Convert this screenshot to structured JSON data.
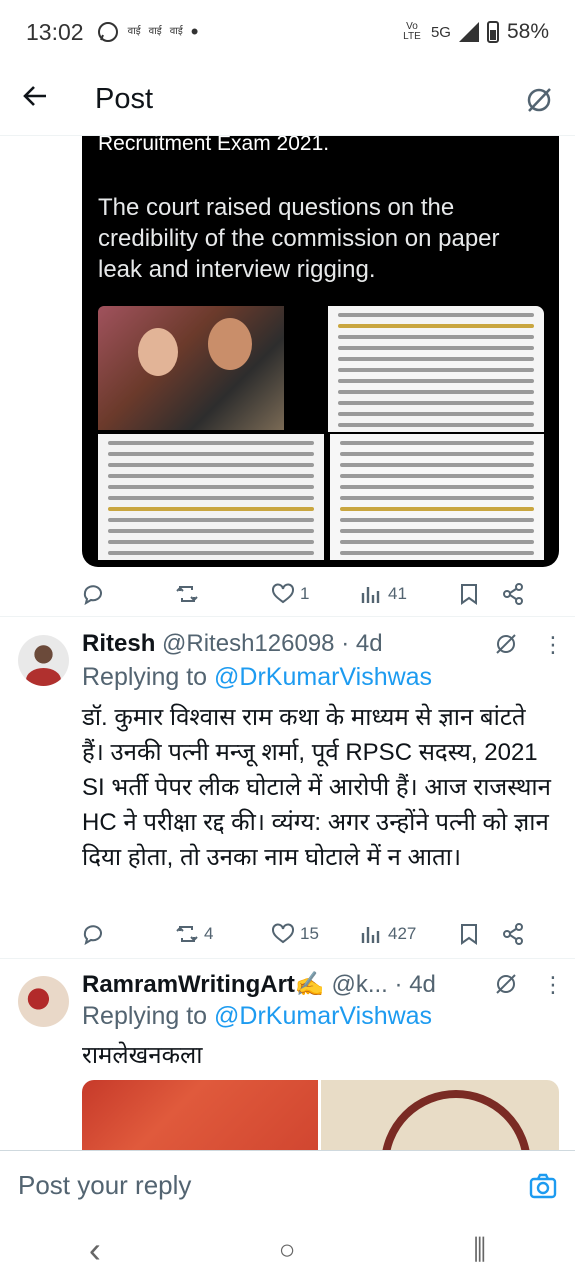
{
  "status_bar": {
    "time": "13:02",
    "net_icons": [
      "वाई",
      "वाई",
      "वाई"
    ],
    "dot": "•",
    "volte": "Vo LTE",
    "network": "5G",
    "battery": "58%"
  },
  "header": {
    "title": "Post"
  },
  "media": {
    "line0": "Recruitment Exam 2021.",
    "paragraph": "The court raised questions on the credibility of the commission on paper leak and interview rigging."
  },
  "post_actions": {
    "replies": "",
    "reposts": "",
    "likes": "1",
    "views": "41"
  },
  "replies": [
    {
      "display_name": "Ritesh",
      "handle": "@Ritesh126098",
      "time": "· 4d",
      "replying_label": "Replying to",
      "replying_handle": "@DrKumarVishwas",
      "text": "डॉ. कुमार विश्वास राम कथा के माध्यम से ज्ञान बांटते हैं। उनकी पत्नी मन्जू शर्मा, पूर्व RPSC सदस्य, 2021 SI भर्ती पेपर लीक घोटाले में आरोपी हैं। आज राजस्थान HC ने परीक्षा रद्द की। व्यंग्य: अगर उन्होंने पत्नी को ज्ञान दिया होता, तो उनका नाम घोटाले में न आता।",
      "actions": {
        "replies": "",
        "reposts": "4",
        "likes": "15",
        "views": "427"
      }
    },
    {
      "display_name": "RamramWritingArt✍️",
      "handle": "@k...",
      "time": "· 4d",
      "replying_label": "Replying to",
      "replying_handle": "@DrKumarVishwas",
      "text": "रामलेखनकला"
    }
  ],
  "composer": {
    "placeholder": "Post your reply"
  },
  "nav": {
    "back": "‹",
    "home": "○",
    "recents": "⫼"
  }
}
